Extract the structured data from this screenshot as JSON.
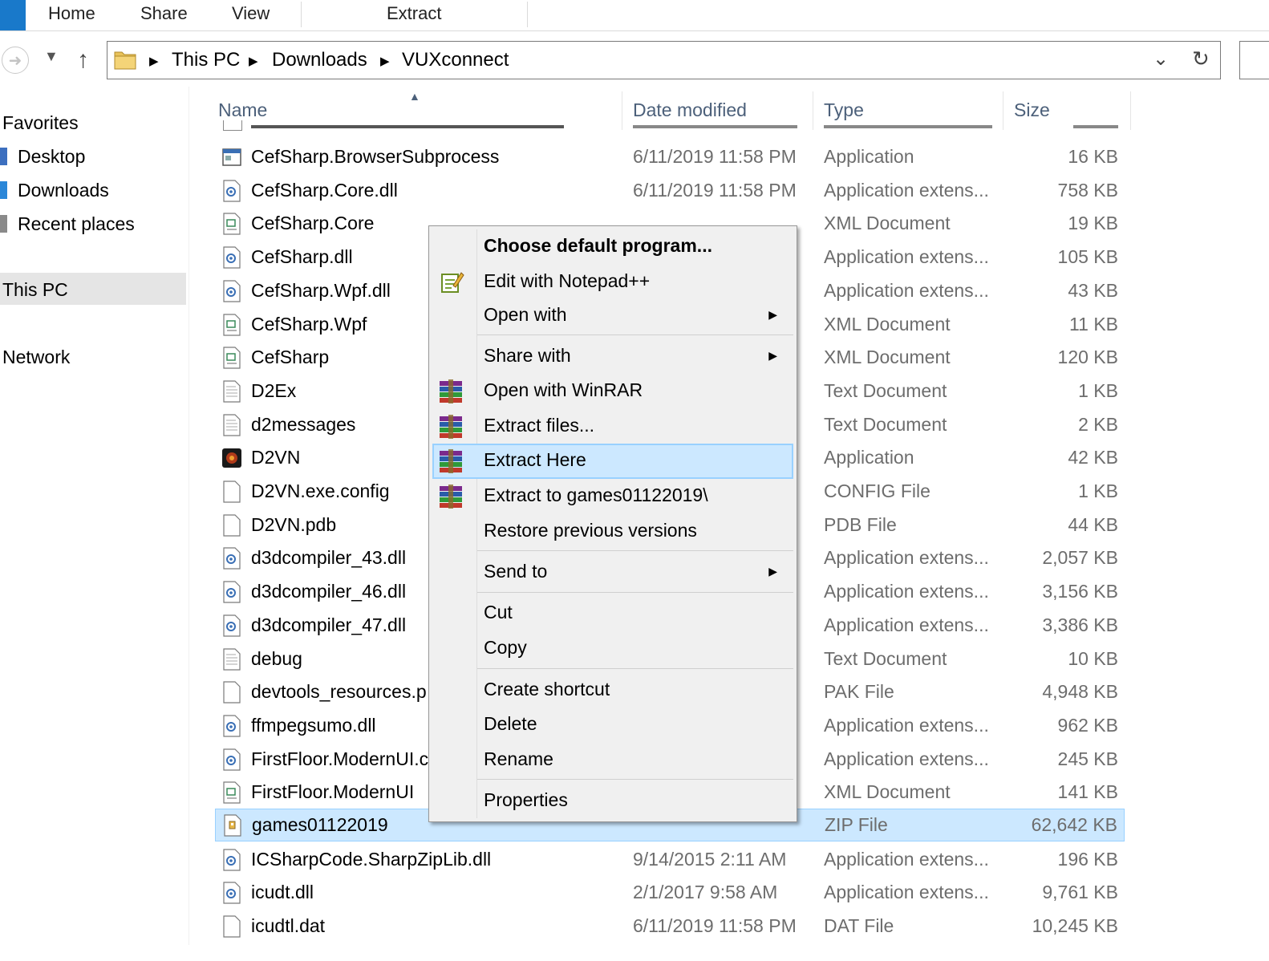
{
  "ribbon": {
    "tabs": [
      "Home",
      "Share",
      "View",
      "Extract"
    ]
  },
  "address": {
    "crumbs": [
      "This PC",
      "Downloads",
      "VUXconnect"
    ]
  },
  "nav_pane": {
    "favorites": "Favorites",
    "desktop": "Desktop",
    "downloads": "Downloads",
    "recent": "Recent places",
    "this_pc": "This PC",
    "network": "Network"
  },
  "columns": {
    "name": "Name",
    "date": "Date modified",
    "type": "Type",
    "size": "Size"
  },
  "files": [
    {
      "name": "CefSharp.BrowserSubprocess",
      "date": "6/11/2019 11:58 PM",
      "type": "Application",
      "size": "16 KB",
      "icon": "application-icon"
    },
    {
      "name": "CefSharp.Core.dll",
      "date": "6/11/2019 11:58 PM",
      "type": "Application extens...",
      "size": "758 KB",
      "icon": "dll-icon"
    },
    {
      "name": "CefSharp.Core",
      "date": "",
      "type": "XML Document",
      "size": "19 KB",
      "icon": "xml-icon"
    },
    {
      "name": "CefSharp.dll",
      "date": "",
      "type": "Application extens...",
      "size": "105 KB",
      "icon": "dll-icon"
    },
    {
      "name": "CefSharp.Wpf.dll",
      "date": "",
      "type": "Application extens...",
      "size": "43 KB",
      "icon": "dll-icon"
    },
    {
      "name": "CefSharp.Wpf",
      "date": "",
      "type": "XML Document",
      "size": "11 KB",
      "icon": "xml-icon"
    },
    {
      "name": "CefSharp",
      "date": "",
      "type": "XML Document",
      "size": "120 KB",
      "icon": "xml-icon"
    },
    {
      "name": "D2Ex",
      "date": "",
      "type": "Text Document",
      "size": "1 KB",
      "icon": "text-icon"
    },
    {
      "name": "d2messages",
      "date": "",
      "type": "Text Document",
      "size": "2 KB",
      "icon": "text-icon"
    },
    {
      "name": "D2VN",
      "date": "",
      "type": "Application",
      "size": "42 KB",
      "icon": "d2vn-app-icon"
    },
    {
      "name": "D2VN.exe.config",
      "date": "",
      "type": "CONFIG File",
      "size": "1 KB",
      "icon": "blank-file-icon"
    },
    {
      "name": "D2VN.pdb",
      "date": "",
      "type": "PDB File",
      "size": "44 KB",
      "icon": "blank-file-icon"
    },
    {
      "name": "d3dcompiler_43.dll",
      "date": "",
      "type": "Application extens...",
      "size": "2,057 KB",
      "icon": "dll-icon"
    },
    {
      "name": "d3dcompiler_46.dll",
      "date": "",
      "type": "Application extens...",
      "size": "3,156 KB",
      "icon": "dll-icon"
    },
    {
      "name": "d3dcompiler_47.dll",
      "date": "",
      "type": "Application extens...",
      "size": "3,386 KB",
      "icon": "dll-icon"
    },
    {
      "name": "debug",
      "date": "",
      "type": "Text Document",
      "size": "10 KB",
      "icon": "text-icon"
    },
    {
      "name": "devtools_resources.p",
      "date": "",
      "type": "PAK File",
      "size": "4,948 KB",
      "icon": "blank-file-icon"
    },
    {
      "name": "ffmpegsumo.dll",
      "date": "",
      "type": "Application extens...",
      "size": "962 KB",
      "icon": "dll-icon"
    },
    {
      "name": "FirstFloor.ModernUI.c",
      "date": "",
      "type": "Application extens...",
      "size": "245 KB",
      "icon": "dll-icon"
    },
    {
      "name": "FirstFloor.ModernUI",
      "date": "",
      "type": "XML Document",
      "size": "141 KB",
      "icon": "xml-icon"
    },
    {
      "name": "games01122019",
      "date": "",
      "type": "ZIP File",
      "size": "62,642 KB",
      "icon": "zip-icon",
      "selected": true
    },
    {
      "name": "ICSharpCode.SharpZipLib.dll",
      "date": "9/14/2015 2:11 AM",
      "type": "Application extens...",
      "size": "196 KB",
      "icon": "dll-icon"
    },
    {
      "name": "icudt.dll",
      "date": "2/1/2017 9:58 AM",
      "type": "Application extens...",
      "size": "9,761 KB",
      "icon": "dll-icon"
    },
    {
      "name": "icudtl.dat",
      "date": "6/11/2019 11:58 PM",
      "type": "DAT File",
      "size": "10,245 KB",
      "icon": "blank-file-icon"
    }
  ],
  "context_menu": {
    "choose_default": "Choose default program...",
    "edit_notepad": "Edit with Notepad++",
    "open_with": "Open with",
    "share_with": "Share with",
    "open_winrar": "Open with WinRAR",
    "extract_files": "Extract files...",
    "extract_here": "Extract Here",
    "extract_to": "Extract to games01122019\\",
    "restore": "Restore previous versions",
    "send_to": "Send to",
    "cut": "Cut",
    "copy": "Copy",
    "create_shortcut": "Create shortcut",
    "delete": "Delete",
    "rename": "Rename",
    "properties": "Properties",
    "highlighted": "Extract Here"
  },
  "colors": {
    "selection": "#cce8ff",
    "selection_border": "#99d1ff",
    "accent": "#1979ca"
  }
}
